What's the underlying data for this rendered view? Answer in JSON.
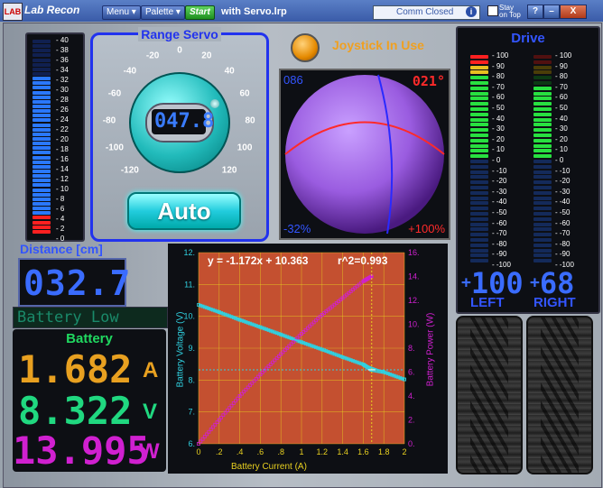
{
  "titlebar": {
    "logo_text": "LAB",
    "app_title": "Lab Recon",
    "menu_label": "Menu",
    "palette_label": "Palette",
    "start_label": "Start",
    "filename": "with Servo.lrp",
    "comm_status": "Comm Closed",
    "comm_info": "i",
    "stay_on_top_label1": "Stay",
    "stay_on_top_label2": "on Top",
    "help": "?",
    "minimize": "–",
    "close": "X"
  },
  "distance_meter": {
    "scale": [
      "40",
      "38",
      "36",
      "34",
      "32",
      "30",
      "28",
      "26",
      "24",
      "22",
      "20",
      "18",
      "16",
      "14",
      "12",
      "10",
      "8",
      "6",
      "4",
      "2",
      "0"
    ],
    "level": 32.7,
    "title": "Distance [cm]",
    "value": "032.7"
  },
  "battery_status": {
    "text": "Battery Low",
    "title": "Battery",
    "current": "1.682",
    "current_unit": "A",
    "voltage": "8.322",
    "voltage_unit": "V",
    "power": "13.995",
    "power_unit": "W"
  },
  "range_servo": {
    "title": "Range Servo",
    "dial_labels": [
      "-120",
      "-100",
      "-80",
      "-60",
      "-40",
      "-20",
      "0",
      "20",
      "40",
      "60",
      "80",
      "100",
      "120"
    ],
    "value": "047.8",
    "auto_label": "Auto"
  },
  "joystick": {
    "indicator_label": "Joystick In Use",
    "top_left": "086",
    "top_right": "021°",
    "bottom_left": "-32%",
    "bottom_right": "+100%"
  },
  "drive": {
    "title": "Drive",
    "scale": [
      "100",
      "90",
      "80",
      "70",
      "60",
      "50",
      "40",
      "30",
      "20",
      "10",
      "0",
      "-10",
      "-20",
      "-30",
      "-40",
      "-50",
      "-60",
      "-70",
      "-80",
      "-90",
      "-100"
    ],
    "left_level": 100,
    "right_level": 68,
    "left_value": "100",
    "right_value": "68",
    "left_label": "LEFT",
    "right_label": "RIGHT",
    "sign": "+"
  },
  "colors": {
    "accent_blue": "#2233ee",
    "amber": "#e8a020",
    "green": "#20d860",
    "magenta": "#d020d0",
    "cyan": "#30d0e0"
  },
  "chart_data": {
    "type": "scatter",
    "equation": "y = -1.172x + 10.363",
    "r2": "r^2=0.993",
    "xlabel": "Battery Current (A)",
    "ylabel": "Battery Voltage (V)",
    "y2label": "Battery Power (W)",
    "xlim": [
      0,
      2
    ],
    "ylim": [
      6,
      12
    ],
    "y2lim": [
      0,
      16
    ],
    "x_ticks": [
      "0",
      ".2",
      ".4",
      ".6",
      ".8",
      "1",
      "1.2",
      "1.4",
      "1.6",
      "1.8",
      "2"
    ],
    "y_ticks": [
      "6.",
      "7.",
      "8.",
      "9.",
      "10.",
      "11.",
      "12."
    ],
    "y2_ticks": [
      "0.",
      "2.",
      "4.",
      "6.",
      "8.",
      "10.",
      "12.",
      "14.",
      "16."
    ],
    "series": [
      {
        "name": "Battery Voltage (V)",
        "axis": "left",
        "x": [
          0.0,
          0.2,
          0.4,
          0.6,
          0.8,
          1.0,
          1.2,
          1.4,
          1.6,
          1.68,
          1.8,
          2.0
        ],
        "y": [
          10.36,
          10.13,
          9.89,
          9.66,
          9.43,
          9.19,
          8.96,
          8.72,
          8.49,
          8.32,
          8.25,
          8.02
        ]
      },
      {
        "name": "Battery Power (W)",
        "axis": "right",
        "x": [
          0.0,
          0.2,
          0.4,
          0.6,
          0.8,
          1.0,
          1.2,
          1.4,
          1.6,
          1.68
        ],
        "y": [
          0.0,
          2.0,
          4.0,
          5.8,
          7.5,
          9.2,
          10.8,
          12.2,
          13.6,
          14.0
        ]
      }
    ],
    "marker": {
      "x": 1.682,
      "y": 8.322
    }
  }
}
